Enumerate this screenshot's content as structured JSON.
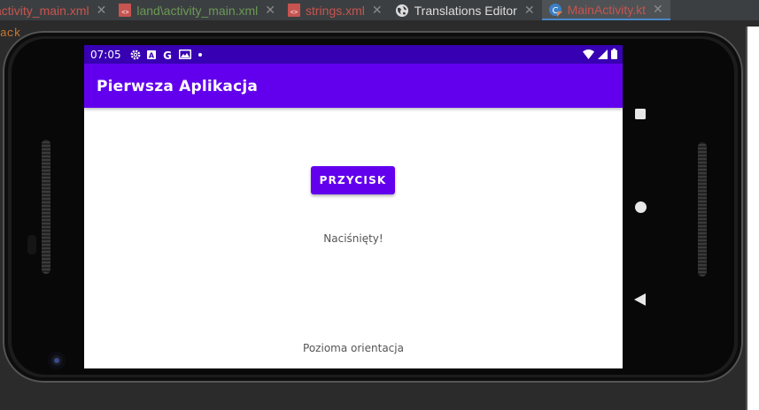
{
  "ide": {
    "tabs": [
      {
        "label": "activity_main.xml",
        "color": "#c75450",
        "active": false
      },
      {
        "label": "land\\activity_main.xml",
        "color": "#6a9955",
        "active": false
      },
      {
        "label": "strings.xml",
        "color": "#c75450",
        "active": false
      },
      {
        "label": "Translations Editor",
        "color": "#dddddd",
        "active": false
      },
      {
        "label": "MainActivity.kt",
        "color": "#c75450",
        "active": true
      }
    ],
    "editor_hint": "ack"
  },
  "device": {
    "status_bar": {
      "time": "07:05",
      "icons": [
        "gear-icon",
        "a-icon",
        "g-icon",
        "gallery-icon",
        "dot-icon"
      ],
      "right_icons": [
        "wifi-icon",
        "signal-icon",
        "battery-icon"
      ]
    },
    "app_bar": {
      "title": "Pierwsza Aplikacja",
      "color": "#6200ee",
      "status_color": "#3700b3"
    },
    "button": {
      "label": "PRZYCISK"
    },
    "pressed_text": "Naciśnięty!",
    "orientation_text": "Pozioma orientacja",
    "nav": [
      "square-icon",
      "circle-icon",
      "back-triangle-icon"
    ]
  }
}
